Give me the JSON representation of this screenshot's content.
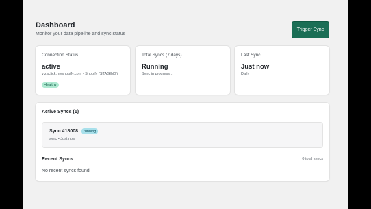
{
  "header": {
    "title": "Dashboard",
    "subtitle": "Monitor your data pipeline and sync status",
    "trigger_label": "Trigger Sync"
  },
  "cards": {
    "connection": {
      "label": "Connection Status",
      "value": "active",
      "sub": "vizaclick.myshopify.com - Shopify (STAGING)",
      "badge": "Healthy"
    },
    "total": {
      "label": "Total Syncs (7 days)",
      "value": "Running",
      "sub": "Sync in progress..."
    },
    "last": {
      "label": "Last Sync",
      "value": "Just now",
      "sub": "Daily"
    }
  },
  "active_syncs": {
    "title": "Active Syncs (1)",
    "items": [
      {
        "name": "Sync #18008",
        "status": "running",
        "meta": "sync • Just now"
      }
    ]
  },
  "recent_syncs": {
    "title": "Recent Syncs",
    "count": "0 total syncs",
    "empty": "No recent syncs found"
  },
  "colors": {
    "accent": "#1a6e55",
    "healthy_bg": "#aee9d1",
    "running_bg": "#a8e0eb"
  }
}
